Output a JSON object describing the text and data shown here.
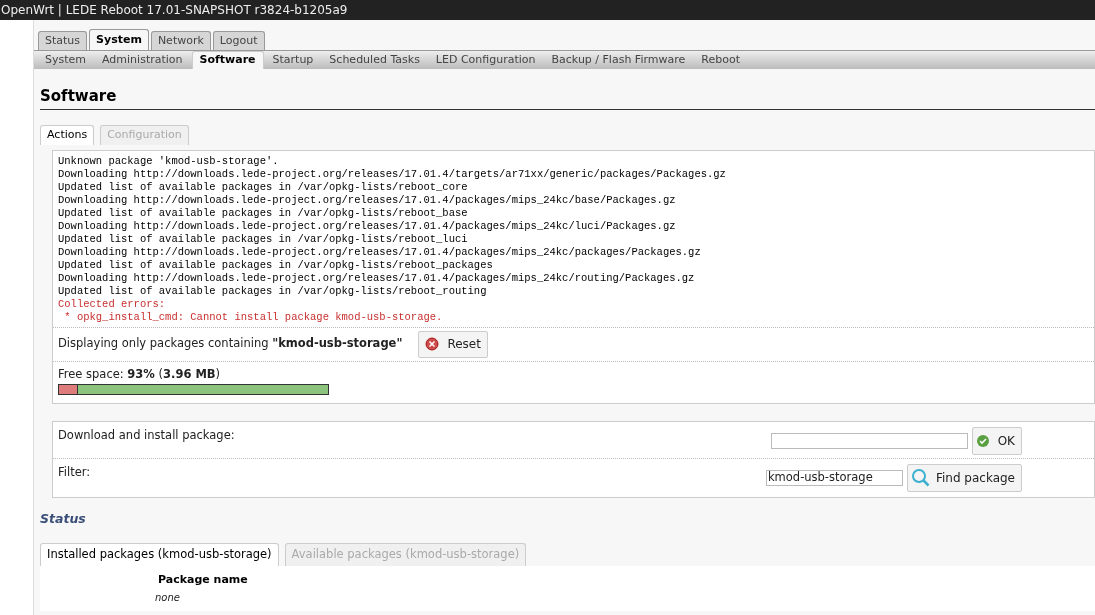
{
  "window": {
    "title": "OpenWrt | LEDE Reboot 17.01-SNAPSHOT r3824-b1205a9"
  },
  "main_tabs": [
    {
      "label": "Status",
      "selected": false
    },
    {
      "label": "System",
      "selected": true
    },
    {
      "label": "Network",
      "selected": false
    },
    {
      "label": "Logout",
      "selected": false
    }
  ],
  "sub_tabs": [
    {
      "label": "System",
      "selected": false
    },
    {
      "label": "Administration",
      "selected": false
    },
    {
      "label": "Software",
      "selected": true
    },
    {
      "label": "Startup",
      "selected": false
    },
    {
      "label": "Scheduled Tasks",
      "selected": false
    },
    {
      "label": "LED Configuration",
      "selected": false
    },
    {
      "label": "Backup / Flash Firmware",
      "selected": false
    },
    {
      "label": "Reboot",
      "selected": false
    }
  ],
  "page_title": "Software",
  "section_tabs": [
    {
      "label": "Actions",
      "selected": true
    },
    {
      "label": "Configuration",
      "selected": false
    }
  ],
  "log": [
    {
      "text": "Unknown package 'kmod-usb-storage'.",
      "error": false
    },
    {
      "text": "Downloading http://downloads.lede-project.org/releases/17.01.4/targets/ar71xx/generic/packages/Packages.gz",
      "error": false
    },
    {
      "text": "Updated list of available packages in /var/opkg-lists/reboot_core",
      "error": false
    },
    {
      "text": "Downloading http://downloads.lede-project.org/releases/17.01.4/packages/mips_24kc/base/Packages.gz",
      "error": false
    },
    {
      "text": "Updated list of available packages in /var/opkg-lists/reboot_base",
      "error": false
    },
    {
      "text": "Downloading http://downloads.lede-project.org/releases/17.01.4/packages/mips_24kc/luci/Packages.gz",
      "error": false
    },
    {
      "text": "Updated list of available packages in /var/opkg-lists/reboot_luci",
      "error": false
    },
    {
      "text": "Downloading http://downloads.lede-project.org/releases/17.01.4/packages/mips_24kc/packages/Packages.gz",
      "error": false
    },
    {
      "text": "Updated list of available packages in /var/opkg-lists/reboot_packages",
      "error": false
    },
    {
      "text": "Downloading http://downloads.lede-project.org/releases/17.01.4/packages/mips_24kc/routing/Packages.gz",
      "error": false
    },
    {
      "text": "Updated list of available packages in /var/opkg-lists/reboot_routing",
      "error": false
    },
    {
      "text": "Collected errors:",
      "error": true
    },
    {
      "text": " * opkg_install_cmd: Cannot install package kmod-usb-storage.",
      "error": true
    }
  ],
  "filter_notice": {
    "text": "Displaying only packages containing **\"kmod-usb-storage\"**",
    "button": "Reset"
  },
  "free_space": {
    "text": "Free space: **93%** (**3.96 MB**)",
    "level": 0.07
  },
  "install": {
    "label": "Download and install package:",
    "button": "OK"
  },
  "filter": {
    "label": "Filter:",
    "value": "kmod-usb-storage",
    "button": "Find package"
  },
  "status_title": "Status",
  "status_tabs": [
    {
      "label": "Installed packages (kmod-usb-storage)",
      "selected": true
    },
    {
      "label": "Available packages (kmod-usb-storage)",
      "selected": false
    }
  ],
  "table": {
    "column": "Package name",
    "empty": "none"
  }
}
